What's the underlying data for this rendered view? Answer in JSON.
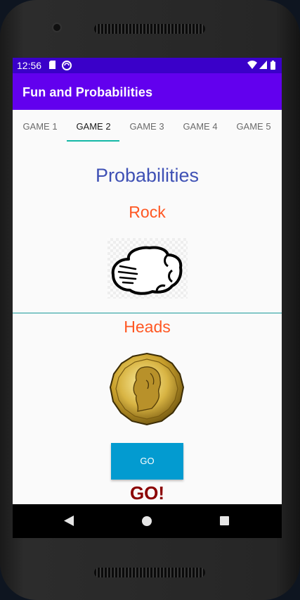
{
  "status_bar": {
    "time": "12:56"
  },
  "app_bar": {
    "title": "Fun and Probabilities"
  },
  "tabs": [
    {
      "label": "GAME 1"
    },
    {
      "label": "GAME 2"
    },
    {
      "label": "GAME 3"
    },
    {
      "label": "GAME 4"
    },
    {
      "label": "GAME 5"
    }
  ],
  "active_tab_index": 1,
  "content": {
    "title": "Probabilities",
    "hand_result": "Rock",
    "coin_result": "Heads",
    "go_button_label": "GO",
    "go_caption": "GO!"
  },
  "colors": {
    "status_bar": "#3a00c9",
    "app_bar": "#6200ee",
    "tab_indicator": "#14b8a6",
    "title": "#3f51b5",
    "result_text": "#ff5722",
    "go_button": "#039bd0",
    "go_caption": "#8b0000"
  },
  "icons": {
    "hand": "rock-fist-icon",
    "coin": "loonie-coin-heads-icon",
    "nav": [
      "back-icon",
      "home-icon",
      "recents-icon"
    ]
  }
}
